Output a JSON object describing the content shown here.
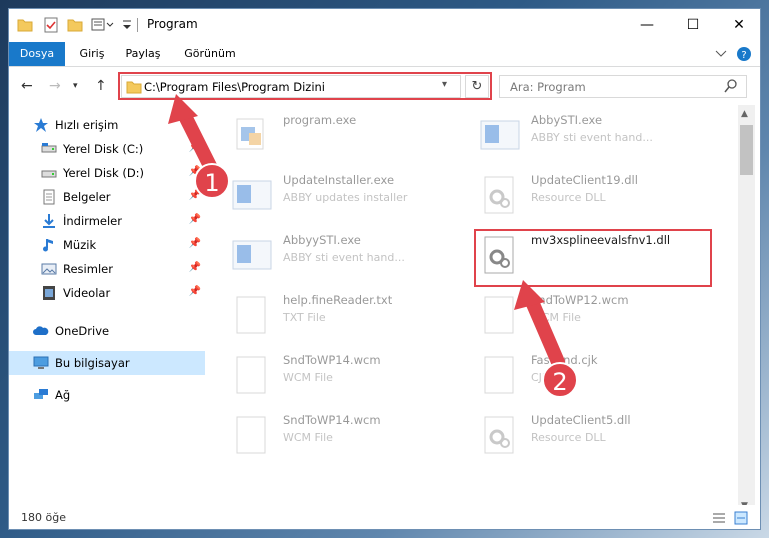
{
  "window": {
    "title": "Program",
    "controls": {
      "minimize": "—",
      "maximize": "☐",
      "close": "✕"
    }
  },
  "ribbon": {
    "tabs": [
      "Dosya",
      "Giriş",
      "Paylaş",
      "Görünüm"
    ]
  },
  "address": {
    "path": "C:\\Program Files\\Program Dizini"
  },
  "search": {
    "placeholder": "Ara: Program"
  },
  "nav": {
    "items": [
      {
        "label": "Hızlı erişim",
        "icon": "star-icon"
      },
      {
        "label": "Yerel Disk (C:)",
        "icon": "drive-icon"
      },
      {
        "label": "Yerel Disk (D:)",
        "icon": "drive-icon"
      },
      {
        "label": "Belgeler",
        "icon": "documents-icon"
      },
      {
        "label": "İndirmeler",
        "icon": "download-icon"
      },
      {
        "label": "Müzik",
        "icon": "music-icon"
      },
      {
        "label": "Resimler",
        "icon": "pictures-icon"
      },
      {
        "label": "Videolar",
        "icon": "videos-icon"
      },
      {
        "label": "OneDrive",
        "icon": "cloud-icon"
      },
      {
        "label": "Bu bilgisayar",
        "icon": "computer-icon"
      },
      {
        "label": "Ağ",
        "icon": "network-icon"
      }
    ]
  },
  "files": {
    "items": [
      {
        "name": "program.exe",
        "type": ""
      },
      {
        "name": "AbbySTI.exe",
        "type": "ABBY sti event hand..."
      },
      {
        "name": "UpdateInstaller.exe",
        "type": "ABBY updates installer"
      },
      {
        "name": "UpdateClient19.dll",
        "type": "Resource DLL"
      },
      {
        "name": "AbbyySTI.exe",
        "type": "ABBY sti event hand..."
      },
      {
        "name": "mv3xsplineevalsfnv1.dll",
        "type": ""
      },
      {
        "name": "help.fineReader.txt",
        "type": "TXT File"
      },
      {
        "name": "SndToWP12.wcm",
        "type": "WCM File"
      },
      {
        "name": "SndToWP14.wcm",
        "type": "WCM File"
      },
      {
        "name": "FastFind.cjk",
        "type": "CJK File"
      },
      {
        "name": "SndToWP14.wcm",
        "type": "WCM File"
      },
      {
        "name": "UpdateClient5.dll",
        "type": "Resource DLL"
      }
    ]
  },
  "status": {
    "count": "180 öğe"
  },
  "callouts": [
    "1",
    "2"
  ],
  "colors": {
    "accent": "#1979ca",
    "highlight": "#e0434b",
    "selection": "#cce8ff"
  }
}
